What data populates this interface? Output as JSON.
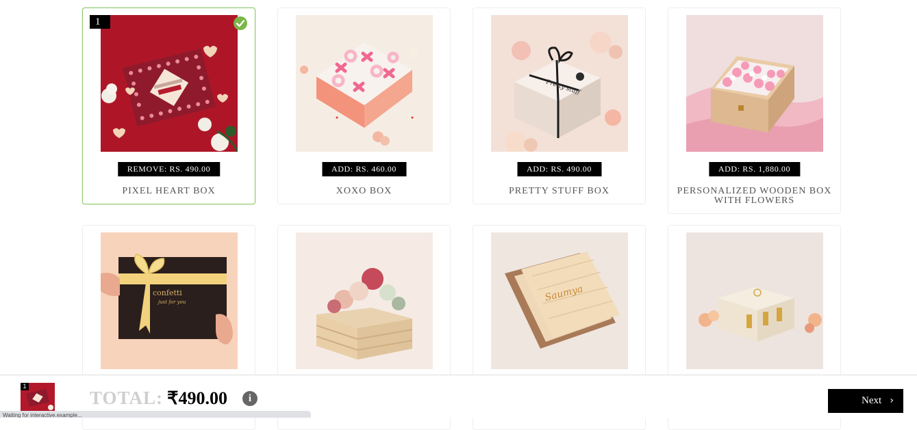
{
  "products": [
    {
      "qty_badge": "1",
      "price_label": "REMOVE: RS. 490.00",
      "name": "PIXEL HEART BOX",
      "selected": true,
      "image_icon": "pixel-heart-box-image"
    },
    {
      "price_label": "ADD: RS. 460.00",
      "name": "XOXO BOX",
      "image_icon": "xoxo-box-image"
    },
    {
      "price_label": "ADD: RS. 490.00",
      "name": "PRETTY STUFF BOX",
      "image_icon": "pretty-stuff-box-image"
    },
    {
      "price_label": "ADD: RS. 1,880.00",
      "name": "PERSONALIZED WOODEN BOX WITH FLOWERS",
      "image_icon": "wooden-flower-box-image"
    },
    {
      "image_icon": "confetti-box-image"
    },
    {
      "image_icon": "wooden-crate-flowers-image"
    },
    {
      "image_icon": "engraved-wooden-box-image"
    },
    {
      "image_icon": "trunk-box-image"
    }
  ],
  "footer": {
    "thumb_badge": "1",
    "total_label": "TOTAL:",
    "total_value": "₹490.00",
    "info_icon": "i",
    "next_label": "Next",
    "next_icon": "›"
  },
  "status_bar": {
    "text": "Waiting for interactive.example..."
  },
  "colors": {
    "selected_border": "#8cc86a",
    "check": "#7ab648",
    "button": "#000000",
    "total_label": "#cfcfcf"
  }
}
